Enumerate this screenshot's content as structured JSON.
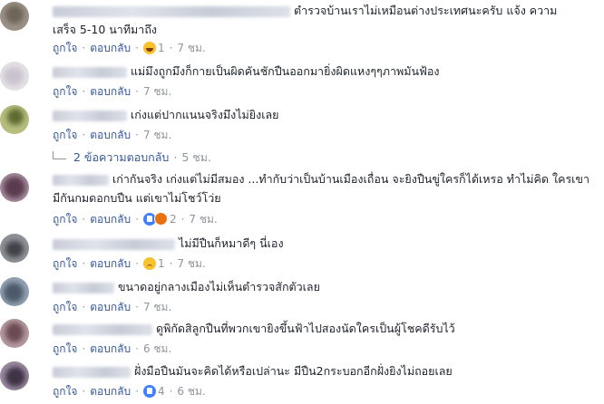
{
  "labels": {
    "like": "ถูกใจ",
    "reply": "ตอบกลับ"
  },
  "comments": [
    {
      "line1": "ตำรวจบ้านเราไม่เหมือนต่างประเทศนะครับ แจ้ง ความ",
      "line2": "เสร็จ 5-10 นาทีมาถึง",
      "reaction": "haha",
      "count": "1",
      "time": "7 ชม."
    },
    {
      "line1": "แม่มึงถูกมึงก็กายเป็นผิดคันชักปืนออกมายิ่งผิดแหงๆๆภาพมันฟ้อง",
      "count": "",
      "time": "7 ชม."
    },
    {
      "line1": "เก่งแต่ปากแนนจริงมึงไม่ยิงเลย",
      "count": "",
      "time": "7 ชม."
    },
    {
      "line1": "เก่ากันจริง เก่งแต่ไม่มีสมอง ...ทำกับว่าเป็นบ้านเมืองเถื่อน จะยิงปืนขู่ใครก็ได้เหรอ ทำไม่คิด ใครเขา",
      "line2": "มีกันกมดอกบปืน แต่เขาไม่โชว์โว่ย",
      "reaction": "like-angry",
      "count": "2",
      "time": "7 ชม."
    },
    {
      "line1": "ไม่มีปืนก็หมาดีๆ นี่เอง",
      "reaction": "sad",
      "count": "1",
      "time": "7 ชม."
    },
    {
      "line1": "ขนาดอยู่กลางเมืองไม่เห็นตำรวจสักตัวเลย",
      "count": "",
      "time": "7 ชม."
    },
    {
      "line1": "ดูพิกัดสิลูกปืนที่พวกเขายิงขึ้นฟ้าไปสองนัดใครเป็นผู้โชคดีรับไว้",
      "count": "",
      "time": "6 ชม."
    },
    {
      "line1": "ฝั่งมือปืนมันจะคิดได้หรือเปล่านะ มีปืน2กระบอกอีกฝั่งยิงไม่ถอยเลย",
      "reaction": "like",
      "count": "4",
      "time": "6 ชม."
    }
  ],
  "replies_link": {
    "text": "2 ข้อความตอบกลับ",
    "time": "5 ชม."
  },
  "colors": {
    "link": "#365899",
    "muted": "#90949c",
    "text": "#1d2129"
  }
}
